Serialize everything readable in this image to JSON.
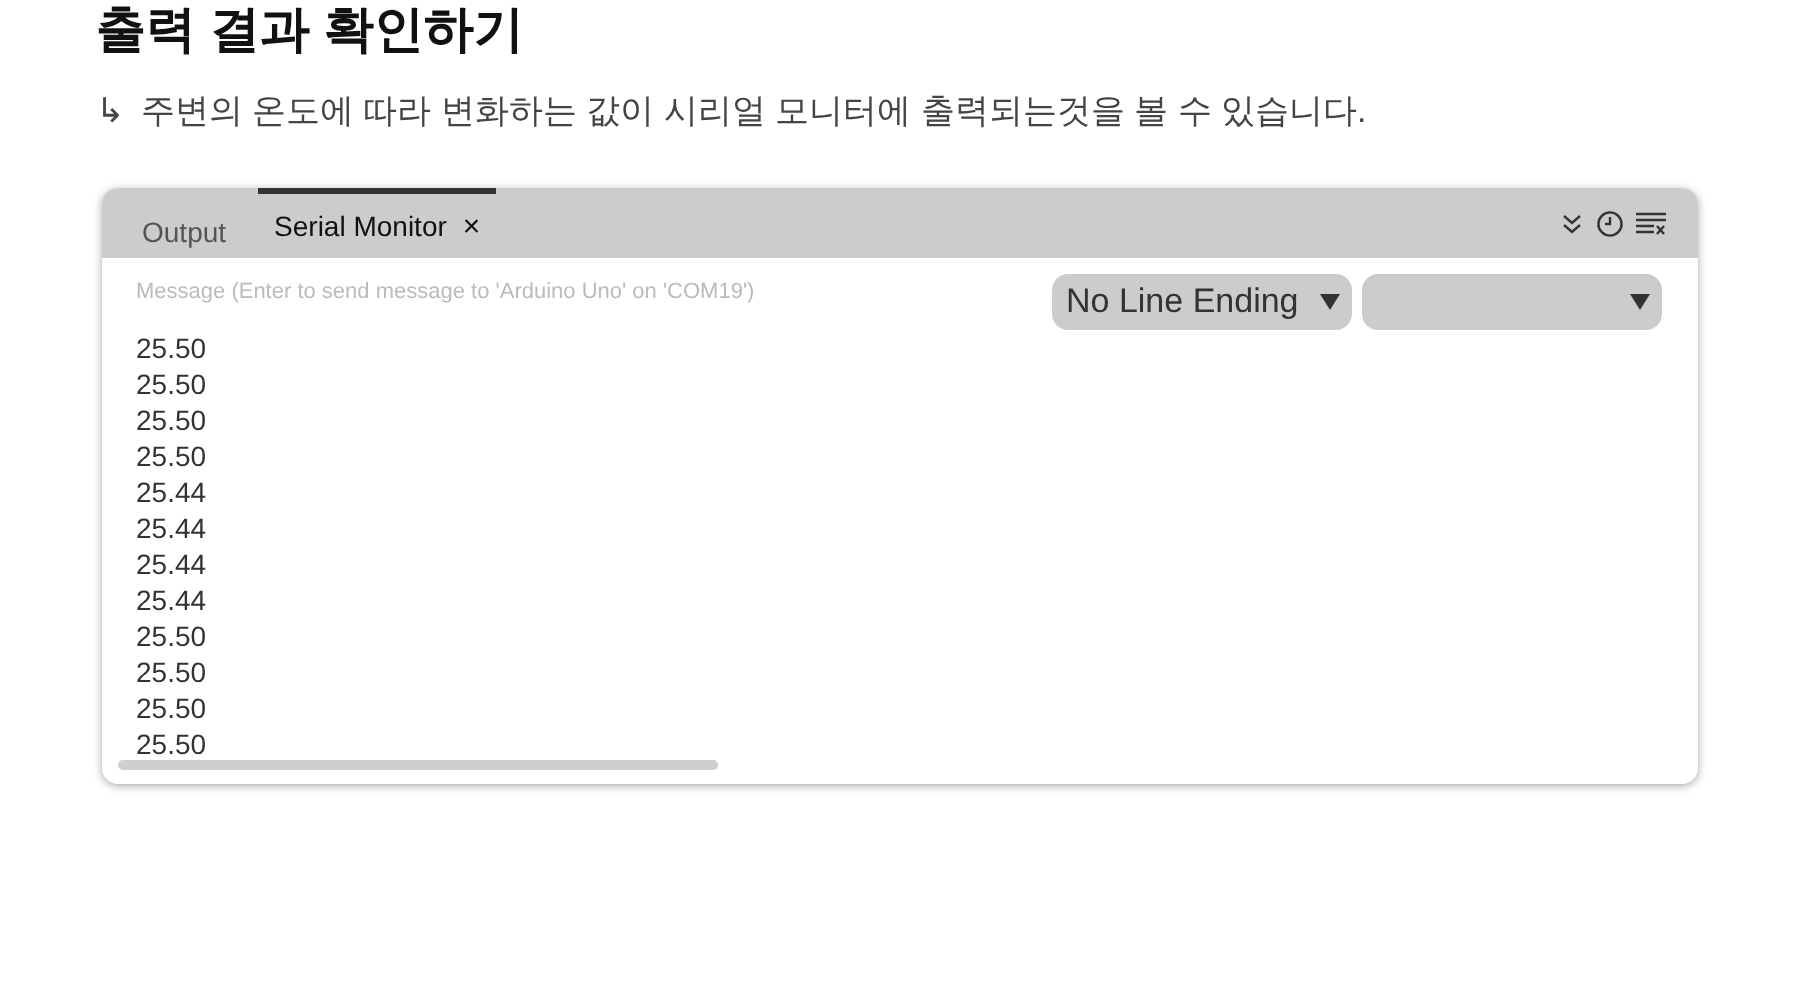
{
  "heading": "출력 결과 확인하기",
  "subtitle": {
    "arrow": "↳",
    "text": "주변의 온도에 따라 변화하는 값이 시리얼 모니터에 출력되는것을 볼 수 있습니다."
  },
  "panel": {
    "tabs": [
      {
        "label": "Output",
        "selected": false
      },
      {
        "label": "Serial Monitor",
        "selected": true,
        "close": "×"
      }
    ],
    "message": {
      "placeholder": "Message (Enter to send message to 'Arduino Uno' on 'COM19')"
    },
    "line_ending": {
      "value": "No Line Ending"
    },
    "lines": [
      "25.50",
      "25.50",
      "25.50",
      "25.50",
      "25.44",
      "25.44",
      "25.44",
      "25.44",
      "25.50",
      "25.50",
      "25.50",
      "25.50"
    ]
  }
}
